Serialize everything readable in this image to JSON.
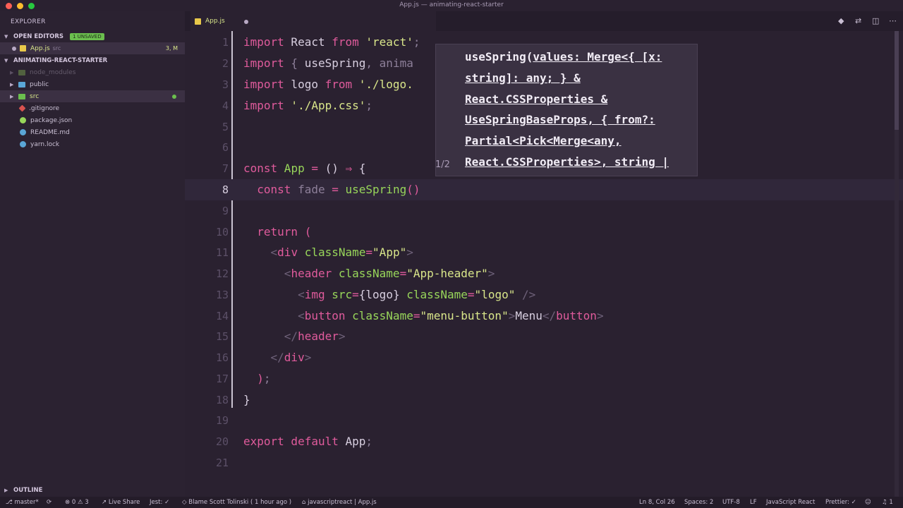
{
  "window": {
    "title": "App.js — animating-react-starter"
  },
  "sidebar": {
    "header": "EXPLORER",
    "open_editors": {
      "label": "OPEN EDITORS",
      "badge": "1 UNSAVED"
    },
    "open_file": {
      "name": "App.js",
      "folder": "src",
      "status": "3, M"
    },
    "project": {
      "label": "ANIMATING-REACT-STARTER"
    },
    "items": [
      {
        "name": "node_modules",
        "kind": "folder"
      },
      {
        "name": "public",
        "kind": "folder"
      },
      {
        "name": "src",
        "kind": "folder"
      },
      {
        "name": ".gitignore",
        "kind": "file"
      },
      {
        "name": "package.json",
        "kind": "file"
      },
      {
        "name": "README.md",
        "kind": "file"
      },
      {
        "name": "yarn.lock",
        "kind": "file"
      }
    ],
    "outline": "OUTLINE"
  },
  "tab": {
    "label": "App.js"
  },
  "editor": {
    "current_line": 8
  },
  "hover": {
    "lines": [
      "useSpring(",
      "values: Merge<{ [x:",
      "string]: any; } &",
      "React.CSSProperties &",
      "UseSpringBaseProps, { from?:",
      "Partial<Pick<Merge<any,",
      "React.CSSProperties>, string |"
    ],
    "counter": "1/2"
  },
  "status": {
    "branch": "master*",
    "errors": "0",
    "warnings": "3",
    "live_share": "Live Share",
    "jest": "Jest: ✓",
    "blame": "Blame Scott Tolinski ( 1 hour ago )",
    "path": "javascriptreact | App.js",
    "position": "Ln 8, Col 26",
    "spaces": "Spaces: 2",
    "encoding": "UTF-8",
    "eol": "LF",
    "language": "JavaScript React",
    "prettier": "Prettier: ✓",
    "bell": "1"
  }
}
